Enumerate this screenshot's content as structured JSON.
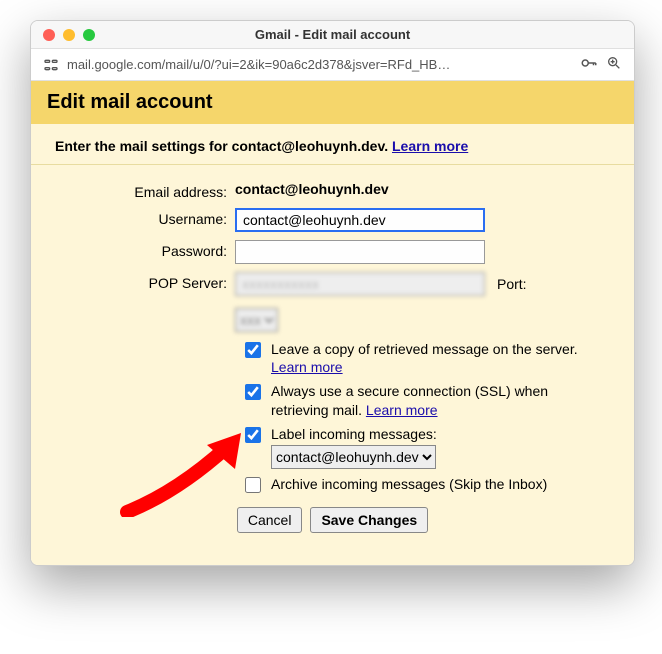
{
  "window": {
    "title": "Gmail - Edit mail account"
  },
  "urlbar": {
    "url": "mail.google.com/mail/u/0/?ui=2&ik=90a6c2d378&jsver=RFd_HB…"
  },
  "header": {
    "title": "Edit mail account"
  },
  "intro": {
    "prefix": "Enter the mail settings for contact@leohuynh.dev. ",
    "learn_more": "Learn more"
  },
  "form": {
    "email_label": "Email address:",
    "email_value": "contact@leohuynh.dev",
    "username_label": "Username:",
    "username_value": "contact@leohuynh.dev",
    "password_label": "Password:",
    "pop_label": "POP Server:",
    "port_label": "Port:",
    "opt_leave_copy": "Leave a copy of retrieved message on the server. ",
    "opt_ssl": "Always use a secure connection (SSL) when retrieving mail. ",
    "opt_label_incoming": "Label incoming messages:",
    "label_select_value": "contact@leohuynh.dev",
    "opt_archive": "Archive incoming messages (Skip the Inbox)",
    "learn_more": "Learn more"
  },
  "buttons": {
    "cancel": "Cancel",
    "save": "Save Changes"
  }
}
